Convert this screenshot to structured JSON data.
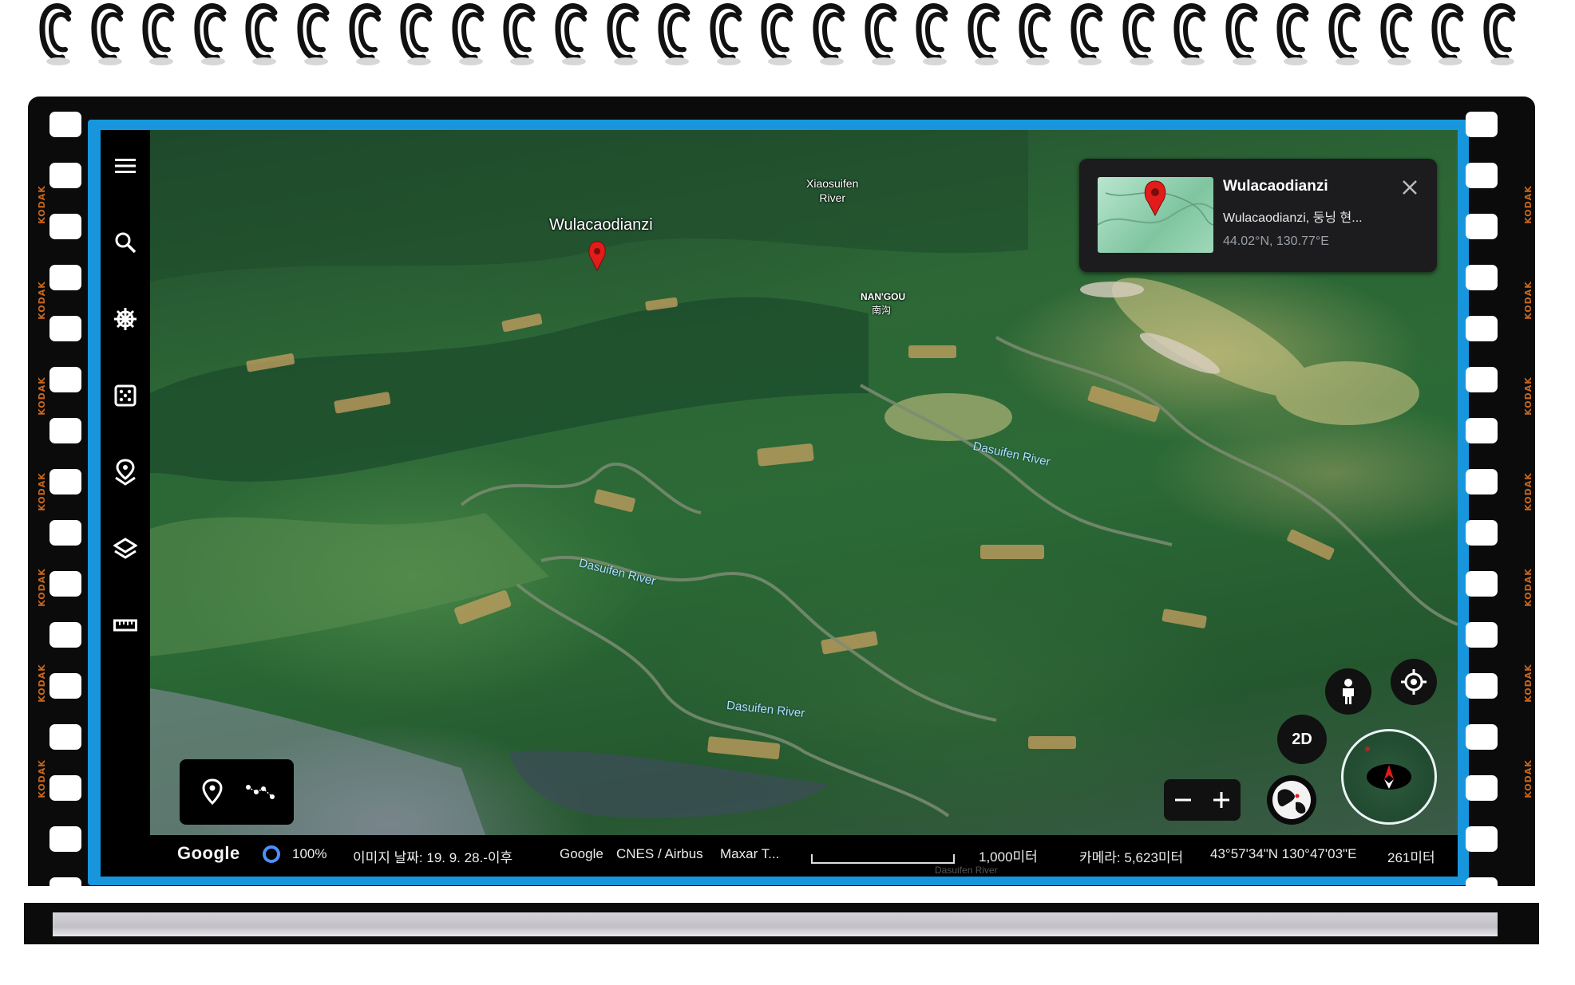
{
  "window": {
    "kind": "Google Earth 3D view inside a decorative notebook / film-strip frame",
    "frame_edge_text": "KODAK"
  },
  "sidebar": {
    "items": [
      {
        "name": "menu",
        "icon": "hamburger-menu-icon"
      },
      {
        "name": "search",
        "icon": "search-icon"
      },
      {
        "name": "voyager",
        "icon": "ship-wheel-icon"
      },
      {
        "name": "feeling-lucky",
        "icon": "dice-icon"
      },
      {
        "name": "projects",
        "icon": "map-pin-stack-icon"
      },
      {
        "name": "map-style",
        "icon": "layers-icon"
      },
      {
        "name": "measure",
        "icon": "ruler-icon"
      }
    ]
  },
  "map": {
    "placemark_label": "Wulacaodianzi",
    "place_labels": {
      "xiaosuifen": "Xiaosuifen\nRiver",
      "nangou_en": "NAN'GOU",
      "nangou_zh": "南沟"
    },
    "river_labels": [
      "Dasuifen River",
      "Dasuifen River",
      "Dasuifen River"
    ],
    "colors": {
      "pin": "#e21b1b",
      "accent": "#4d90fe",
      "bezel": "#1796de"
    }
  },
  "info_card": {
    "title": "Wulacaodianzi",
    "subtitle": "Wulacaodianzi, 둥닝 현...",
    "coordinates": "44.02°N, 130.77°E",
    "close_icon": "close-icon"
  },
  "tools": {
    "items": [
      {
        "name": "add-placemark",
        "icon": "map-pin-icon"
      },
      {
        "name": "draw-path",
        "icon": "path-icon"
      }
    ]
  },
  "nav": {
    "two_d_label": "2D",
    "zoom_out_label": "−",
    "zoom_in_label": "+"
  },
  "status_bar": {
    "logo": "Google",
    "load_percent": "100%",
    "imagery_date": "이미지 날짜: 19. 9. 28.-이후",
    "attribution_1": "Google",
    "attribution_2": "CNES / Airbus",
    "attribution_3": "Maxar T...",
    "scale": "1,000미터",
    "scale_under": "Dasuifen River",
    "camera": "카메라: 5,623미터",
    "cursor_coords": "43°57'34\"N 130°47'03\"E",
    "elevation": "261미터"
  }
}
